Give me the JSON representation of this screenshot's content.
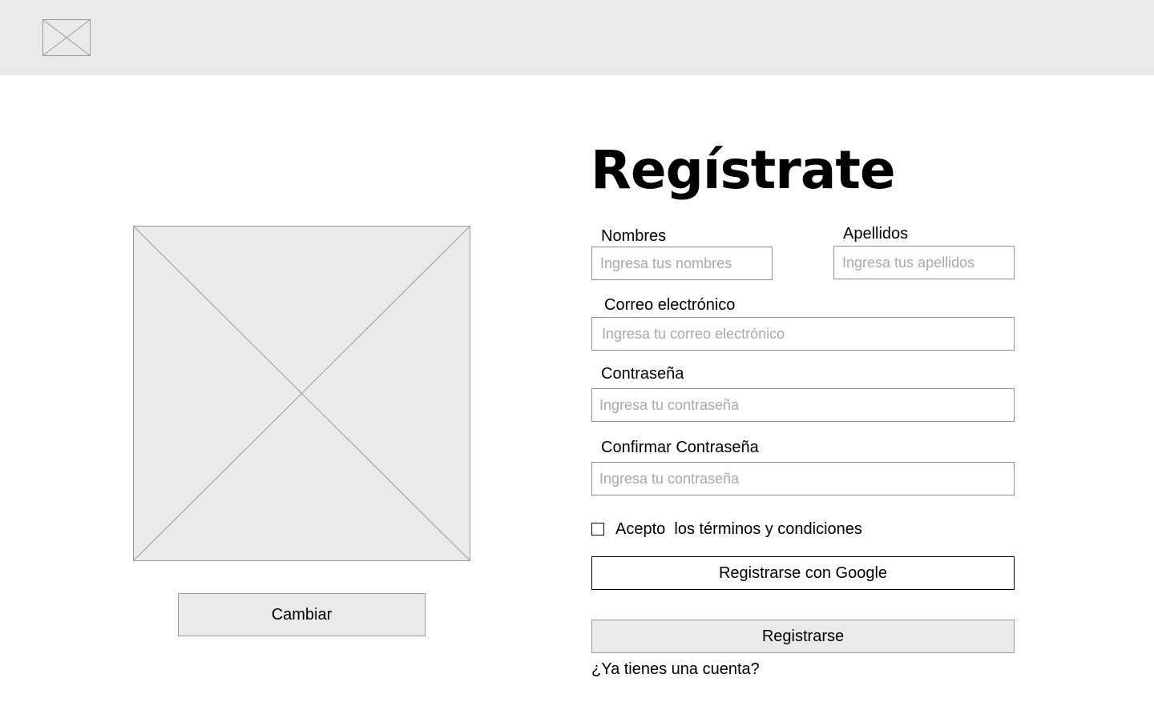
{
  "header": {
    "logo_icon": "image-placeholder-icon"
  },
  "profile": {
    "avatar_icon": "image-placeholder-icon",
    "change_label": "Cambiar"
  },
  "form": {
    "title": "Regístrate",
    "first_name": {
      "label": "Nombres",
      "placeholder": "Ingresa tus nombres",
      "value": ""
    },
    "last_name": {
      "label": "Apellidos",
      "placeholder": "Ingresa tus apellidos",
      "value": ""
    },
    "email": {
      "label": "Correo electrónico",
      "placeholder": "Ingresa tu correo electrónico",
      "value": ""
    },
    "password": {
      "label": "Contraseña",
      "placeholder": "Ingresa tu contraseña",
      "value": ""
    },
    "confirm_password": {
      "label": "Confirmar Contraseña",
      "placeholder": "Ingresa tu contraseña",
      "value": ""
    },
    "terms": {
      "label": "Acepto  los términos y condiciones",
      "checked": false
    },
    "google_button_label": "Registrarse con Google",
    "submit_label": "Registrarse",
    "login_link": "¿Ya tienes una cuenta?"
  },
  "colors": {
    "placeholder_fill": "#eaeaea",
    "border": "#9a9a9a",
    "placeholder_text": "#a9a9a9"
  }
}
